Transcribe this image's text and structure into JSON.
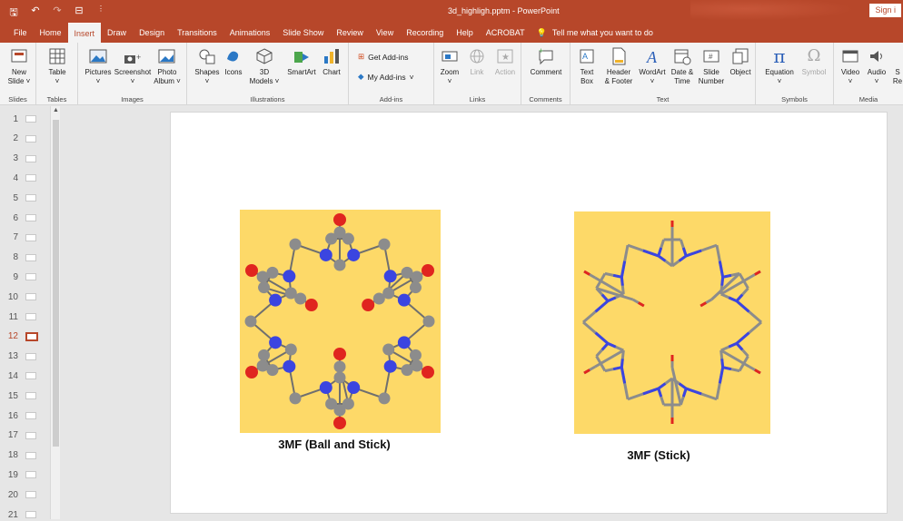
{
  "window": {
    "title": "3d_highligh.pptm  -  PowerPoint",
    "signin": "Sign i"
  },
  "tabs": [
    "File",
    "Home",
    "Insert",
    "Draw",
    "Design",
    "Transitions",
    "Animations",
    "Slide Show",
    "Review",
    "View",
    "Recording",
    "Help",
    "ACROBAT"
  ],
  "active_tab": "Insert",
  "tell_me": "Tell me what you want to do",
  "ribbon": {
    "groups": {
      "slides": "Slides",
      "tables": "Tables",
      "images": "Images",
      "illustrations": "Illustrations",
      "addins": "Add-ins",
      "links": "Links",
      "comments": "Comments",
      "text": "Text",
      "symbols": "Symbols",
      "media": "Media"
    },
    "buttons": {
      "new_slide": [
        "New",
        "Slide ˅"
      ],
      "table": [
        "Table",
        "˅"
      ],
      "pictures": [
        "Pictures",
        "˅"
      ],
      "screenshot": [
        "Screenshot",
        "˅"
      ],
      "photo_album": [
        "Photo",
        "Album ˅"
      ],
      "shapes": [
        "Shapes",
        "˅"
      ],
      "icons": [
        "Icons",
        ""
      ],
      "models3d": [
        "3D",
        "Models ˅"
      ],
      "smartart": [
        "SmartArt",
        ""
      ],
      "chart": [
        "Chart",
        ""
      ],
      "get_addins": "Get Add-ins",
      "my_addins": "My Add-ins",
      "zoom": [
        "Zoom",
        "˅"
      ],
      "link": [
        "Link",
        ""
      ],
      "action": [
        "Action",
        ""
      ],
      "comment": [
        "Comment",
        ""
      ],
      "text_box": [
        "Text",
        "Box"
      ],
      "header_footer": [
        "Header",
        "& Footer"
      ],
      "wordart": [
        "WordArt",
        "˅"
      ],
      "date_time": [
        "Date &",
        "Time"
      ],
      "slide_number": [
        "Slide",
        "Number"
      ],
      "object": [
        "Object",
        ""
      ],
      "equation": [
        "Equation",
        "˅"
      ],
      "symbol": [
        "Symbol",
        ""
      ],
      "video": [
        "Video",
        "˅"
      ],
      "audio": [
        "Audio",
        "˅"
      ],
      "screen_rec": [
        "S",
        "Re"
      ]
    }
  },
  "thumbnails": [
    "1",
    "2",
    "3",
    "4",
    "5",
    "6",
    "7",
    "8",
    "9",
    "10",
    "11",
    "12",
    "13",
    "14",
    "15",
    "16",
    "17",
    "18",
    "19",
    "20",
    "21"
  ],
  "active_slide": "12",
  "slide": {
    "left_caption": "3MF (Ball and Stick)",
    "right_caption": "3MF (Stick)"
  },
  "colors": {
    "accent": "#b7472a",
    "mol_bg": "#fdd968",
    "carbon": "#8c8c8c",
    "nitrogen": "#3b45e0",
    "oxygen": "#e0251f"
  }
}
